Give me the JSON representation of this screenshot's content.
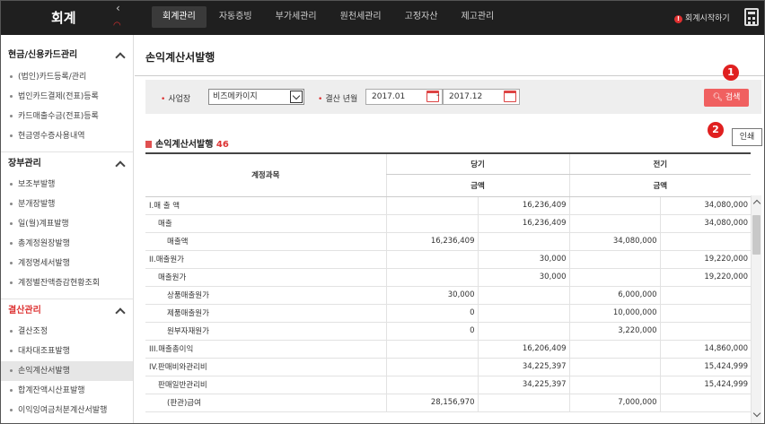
{
  "app": {
    "logo": "회계",
    "start_guide": "회계시작하기"
  },
  "topnav": [
    {
      "label": "회계관리",
      "active": true
    },
    {
      "label": "자동증빙",
      "active": false
    },
    {
      "label": "부가세관리",
      "active": false
    },
    {
      "label": "원천세관리",
      "active": false
    },
    {
      "label": "고정자산",
      "active": false
    },
    {
      "label": "제고관리",
      "active": false
    }
  ],
  "sidebar": {
    "sections": [
      {
        "title": "현금/신용카드관리",
        "items": [
          "(법인)카드등록/관리",
          "법인카드결제(전표)등록",
          "카드매출수금(전표)등록",
          "현금영수증사용내역"
        ]
      },
      {
        "title": "장부관리",
        "items": [
          "보조부발행",
          "분개장발행",
          "일(월)계표발행",
          "총계정원장발행",
          "계정명세서발행",
          "계정별잔액증감현황조회"
        ]
      },
      {
        "title": "결산관리",
        "items": [
          "결산조정",
          "대차대조표발행",
          "손익계산서발행",
          "합계잔액시산표발행",
          "이익잉여금처분계산서발행"
        ],
        "active_item": "손익계산서발행"
      }
    ]
  },
  "page": {
    "title": "손익계산서발행",
    "filter": {
      "biz_label": "사업장",
      "biz_value": "비즈메카이지",
      "period_label": "결산 년월",
      "from": "2017.01",
      "dash": "-",
      "to": "2017.12",
      "search_label": "검색"
    },
    "badges": {
      "one": "1",
      "two": "2"
    },
    "subtitle": "손익계산서발행",
    "count": "46",
    "print_label": "인쇄",
    "table": {
      "col_account": "계정과목",
      "col_current": "당기",
      "col_prior": "전기",
      "col_amount": "금액",
      "rows": [
        {
          "level": 0,
          "name": "I.매 출 액",
          "c1": "",
          "c2": "16,236,409",
          "p1": "",
          "p2": "34,080,000"
        },
        {
          "level": 1,
          "name": "매출",
          "c1": "",
          "c2": "16,236,409",
          "p1": "",
          "p2": "34,080,000"
        },
        {
          "level": 2,
          "name": "매출액",
          "c1": "16,236,409",
          "c2": "",
          "p1": "34,080,000",
          "p2": ""
        },
        {
          "level": 0,
          "name": "II.매출원가",
          "c1": "",
          "c2": "30,000",
          "p1": "",
          "p2": "19,220,000"
        },
        {
          "level": 1,
          "name": "매출원가",
          "c1": "",
          "c2": "30,000",
          "p1": "",
          "p2": "19,220,000"
        },
        {
          "level": 2,
          "name": "상품매출원가",
          "c1": "30,000",
          "c2": "",
          "p1": "6,000,000",
          "p2": ""
        },
        {
          "level": 2,
          "name": "제품매출원가",
          "c1": "0",
          "c2": "",
          "p1": "10,000,000",
          "p2": ""
        },
        {
          "level": 2,
          "name": "원부자재원가",
          "c1": "0",
          "c2": "",
          "p1": "3,220,000",
          "p2": ""
        },
        {
          "level": 0,
          "name": "III.매출총이익",
          "c1": "",
          "c2": "16,206,409",
          "p1": "",
          "p2": "14,860,000"
        },
        {
          "level": 0,
          "name": "IV.판매비와관리비",
          "c1": "",
          "c2": "34,225,397",
          "p1": "",
          "p2": "15,424,999"
        },
        {
          "level": 1,
          "name": "판매일반관리비",
          "c1": "",
          "c2": "34,225,397",
          "p1": "",
          "p2": "15,424,999"
        },
        {
          "level": 2,
          "name": "(판관)급여",
          "c1": "28,156,970",
          "c2": "",
          "p1": "7,000,000",
          "p2": ""
        }
      ]
    }
  }
}
